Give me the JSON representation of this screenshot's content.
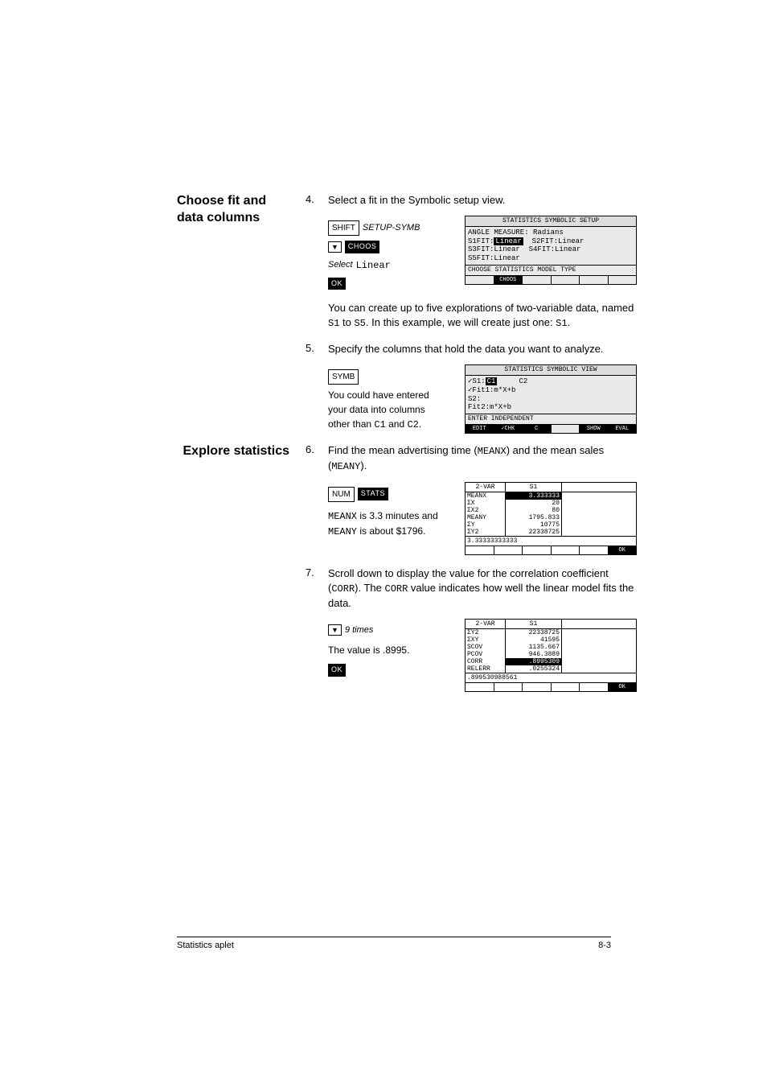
{
  "headings": {
    "choose_fit": "Choose fit and data columns",
    "explore": "Explore statistics"
  },
  "steps": {
    "s4": {
      "num": "4.",
      "text": "Select a fit in the Symbolic setup view."
    },
    "s5": {
      "num": "5.",
      "text": "Specify the columns that hold the data you want to analyze."
    },
    "s6": {
      "num": "6.",
      "text_a": "Find the mean advertising time (",
      "meanx": "MEANX",
      "text_b": ") and the mean sales (",
      "meany": "MEANY",
      "text_c": ")."
    },
    "s7": {
      "num": "7.",
      "text_a": "Scroll down to display the value for the correlation coefficient (",
      "corr": "CORR",
      "text_b": "). The ",
      "text_c": " value indicates how well the linear model fits the data."
    }
  },
  "keys": {
    "shift": "SHIFT",
    "setup_symb": "SETUP-SYMB",
    "choos": "CHOOS",
    "ok": "OK",
    "symb": "SYMB",
    "num": "NUM",
    "stats": "STATS",
    "down": "▼",
    "select_label": "Select",
    "select_value": "Linear",
    "nine_times": "9 times"
  },
  "paragraphs": {
    "p1a": "You can create up to five explorations of two-variable data, named ",
    "p1b": " to ",
    "p1c": ". In this example, we will create just one: ",
    "s1": "S1",
    "s5": "S5",
    "period": ".",
    "p2a": "You could have entered your data into columns other than ",
    "c1": "C1",
    "and": " and ",
    "c2": "C2",
    "p3a": "MEANX",
    "p3b": " is 3.3 minutes and ",
    "p3c": "MEANY",
    "p3d": " is about $1796.",
    "p4": "The value is .8995."
  },
  "screen1": {
    "title": "STATISTICS SYMBOLIC SETUP",
    "angle_label": "ANGLE MEASURE:",
    "angle_value": "Radians",
    "s1fit_l": "S1FIT:",
    "s1fit_v": "Linear",
    "s2fit_l": "S2FIT:",
    "s2fit_v": "Linear",
    "s3fit_l": "S3FIT:",
    "s3fit_v": "Linear",
    "s4fit_l": "S4FIT:",
    "s4fit_v": "Linear",
    "s5fit_l": "S5FIT:",
    "s5fit_v": "Linear",
    "help": "CHOOSE STATISTICS MODEL TYPE",
    "soft": "CHOOS"
  },
  "screen2": {
    "title": "STATISTICS SYMBOLIC VIEW",
    "l1a": "✓S1:",
    "l1b": "C1",
    "l1c": "C2",
    "l2": "✓Fit1:m*X+b",
    "l3": " S2:",
    "l4": " Fit2:m*X+b",
    "help": "ENTER INDEPENDENT",
    "soft": [
      "EDIT",
      "✓CHK",
      "C",
      "",
      "SHOW",
      "EVAL"
    ]
  },
  "stats1": {
    "hdr": [
      "2-VAR",
      "S1",
      ""
    ],
    "rows": [
      [
        "MEANX",
        "3.333333",
        true
      ],
      [
        "ΣX",
        "20",
        false
      ],
      [
        "ΣX2",
        "80",
        false
      ],
      [
        "MEANY",
        "1795.833",
        false
      ],
      [
        "ΣY",
        "10775",
        false
      ],
      [
        "ΣY2",
        "22338725",
        false
      ]
    ],
    "rule": "3.33333333333",
    "ok": "OK"
  },
  "stats2": {
    "hdr": [
      "2-VAR",
      "S1",
      ""
    ],
    "rows": [
      [
        "ΣY2",
        "22338725",
        false
      ],
      [
        "ΣXY",
        "41595",
        false
      ],
      [
        "SCOV",
        "1135.667",
        false
      ],
      [
        "PCOV",
        "946.3889",
        false
      ],
      [
        "CORR",
        ".8995309",
        true
      ],
      [
        "RELERR",
        ".0255324",
        false
      ]
    ],
    "rule": ".899530988561",
    "ok": "OK"
  },
  "footer": {
    "left": "Statistics aplet",
    "right": "8-3"
  }
}
